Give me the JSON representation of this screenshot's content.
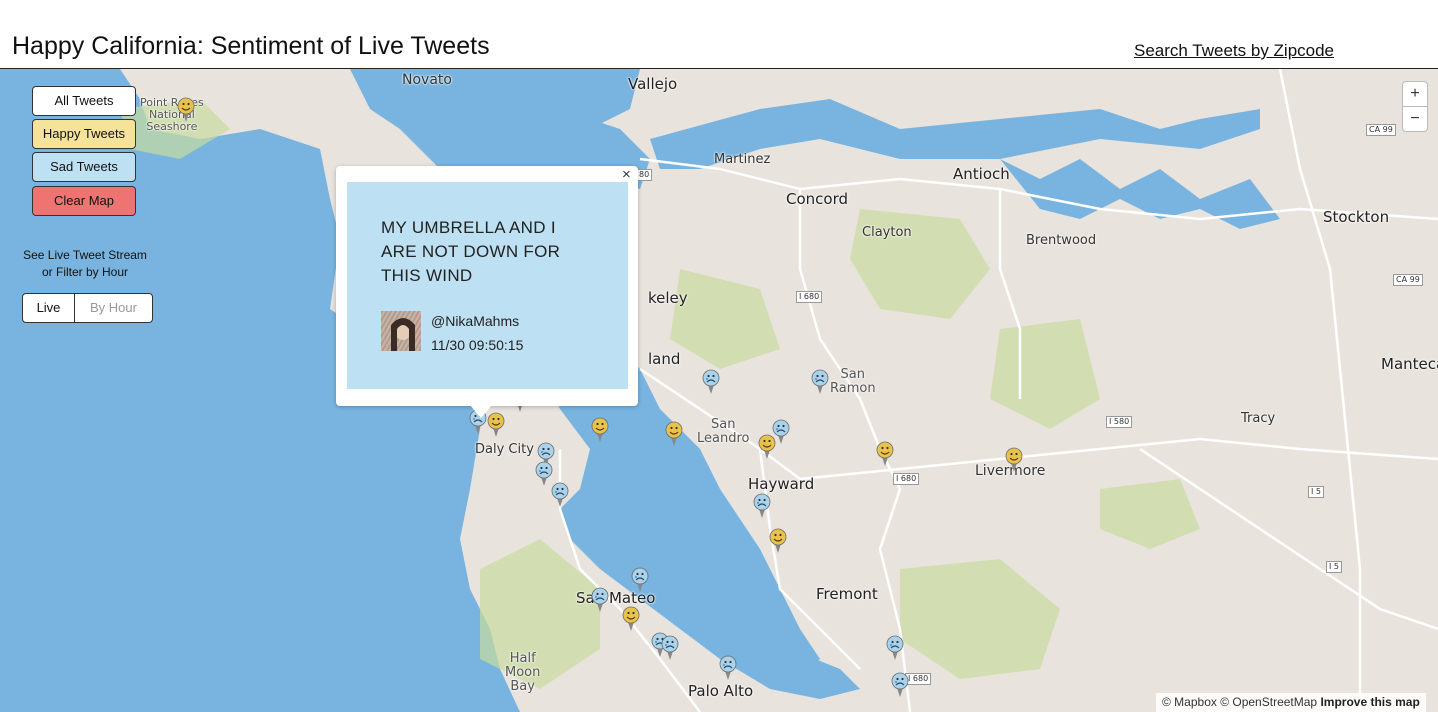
{
  "header": {
    "title": "Happy California: Sentiment of Live Tweets",
    "zip_link": "Search Tweets by Zipcode"
  },
  "controls": {
    "all_tweets": "All Tweets",
    "happy_tweets": "Happy Tweets",
    "sad_tweets": "Sad Tweets",
    "clear_map": "Clear Map",
    "stream_line1": "See Live Tweet Stream",
    "stream_line2": "or Filter by Hour",
    "live": "Live",
    "by_hour": "By Hour"
  },
  "zoom": {
    "in": "+",
    "out": "−"
  },
  "popup": {
    "close": "×",
    "tweet_line1": "MY UMBRELLA AND I",
    "tweet_line2": "ARE NOT DOWN FOR",
    "tweet_line3": "THIS WIND",
    "handle": "@NikaMahms",
    "timestamp": "11/30 09:50:15"
  },
  "map_labels": {
    "novato": "Novato",
    "vallejo": "Vallejo",
    "point_reyes_1": "Point Reyes",
    "point_reyes_2": "National",
    "point_reyes_3": "Seashore",
    "martinez": "Martinez",
    "concord": "Concord",
    "antioch": "Antioch",
    "clayton": "Clayton",
    "brentwood": "Brentwood",
    "stockton": "Stockton",
    "berkeley": "keley",
    "oakland": "land",
    "san_ramon_1": "San",
    "san_ramon_2": "Ramon",
    "san_leandro_1": "San",
    "san_leandro_2": "Leandro",
    "daly_city": "Daly City",
    "hayward": "Hayward",
    "livermore": "Livermore",
    "tracy": "Tracy",
    "manteca": "Manteca",
    "fremont": "Fremont",
    "san_mateo": "San Mateo",
    "half_moon_bay_1": "Half",
    "half_moon_bay_2": "Moon",
    "half_moon_bay_3": "Bay",
    "palo_alto": "Palo Alto"
  },
  "road_shields": {
    "i680_north": "I 680",
    "i680_south": "I 680",
    "i680_far_south": "I 680",
    "i580": "I 580",
    "i5_a": "I 5",
    "i5_b": "I 5",
    "ca99_a": "CA 99",
    "ca99_b": "CA 99",
    "cut_shield": "80"
  },
  "attribution": {
    "text": "© Mapbox © OpenStreetMap",
    "improve": "Improve this map"
  },
  "colors": {
    "water": "#78b4df",
    "land": "#e9e3dd",
    "park": "#c8dca0",
    "happy_button": "#f6e39a",
    "sad_button": "#bde0f3",
    "clear_button": "#ee7472",
    "popup_body": "#bde0f3"
  },
  "markers": {
    "happy_count": 10,
    "sad_count": 16,
    "happy_icon": "happy-face-marker-icon",
    "sad_icon": "sad-face-marker-icon"
  }
}
